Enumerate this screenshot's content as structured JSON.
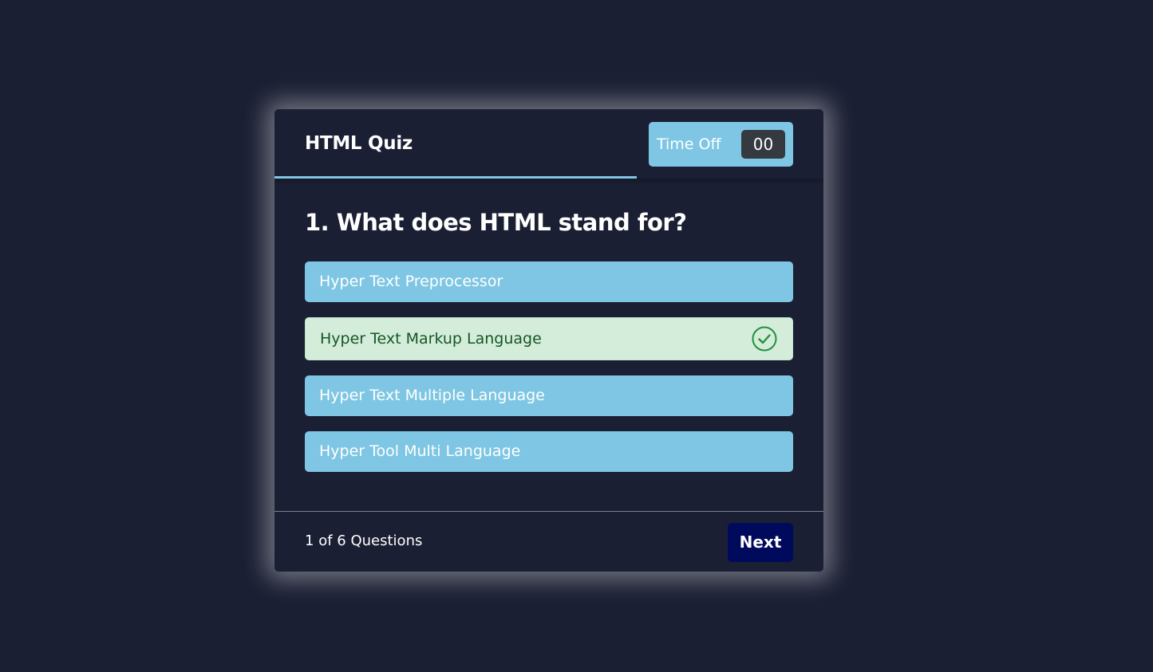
{
  "header": {
    "title": "HTML Quiz",
    "timer": {
      "label": "Time Off",
      "seconds": "00"
    },
    "time_remaining_fraction": 0.66
  },
  "question": {
    "text": "1. What does HTML stand for?"
  },
  "options": [
    {
      "label": "Hyper Text Preprocessor",
      "state": "default"
    },
    {
      "label": "Hyper Text Markup Language",
      "state": "correct",
      "icon": "check-circle-icon"
    },
    {
      "label": "Hyper Text Multiple Language",
      "state": "default"
    },
    {
      "label": "Hyper Tool Multi Language",
      "state": "default"
    }
  ],
  "footer": {
    "counter_current": "1",
    "counter_of": "of",
    "counter_total": "6",
    "counter_suffix": "Questions",
    "next_label": "Next"
  },
  "colors": {
    "background": "#1b1f33",
    "accent": "#7ec6e3",
    "correct_bg": "#d4edda",
    "correct_text": "#155724",
    "correct_icon": "#23903c",
    "next_button": "#000a5c",
    "timer_box": "#343a40"
  }
}
